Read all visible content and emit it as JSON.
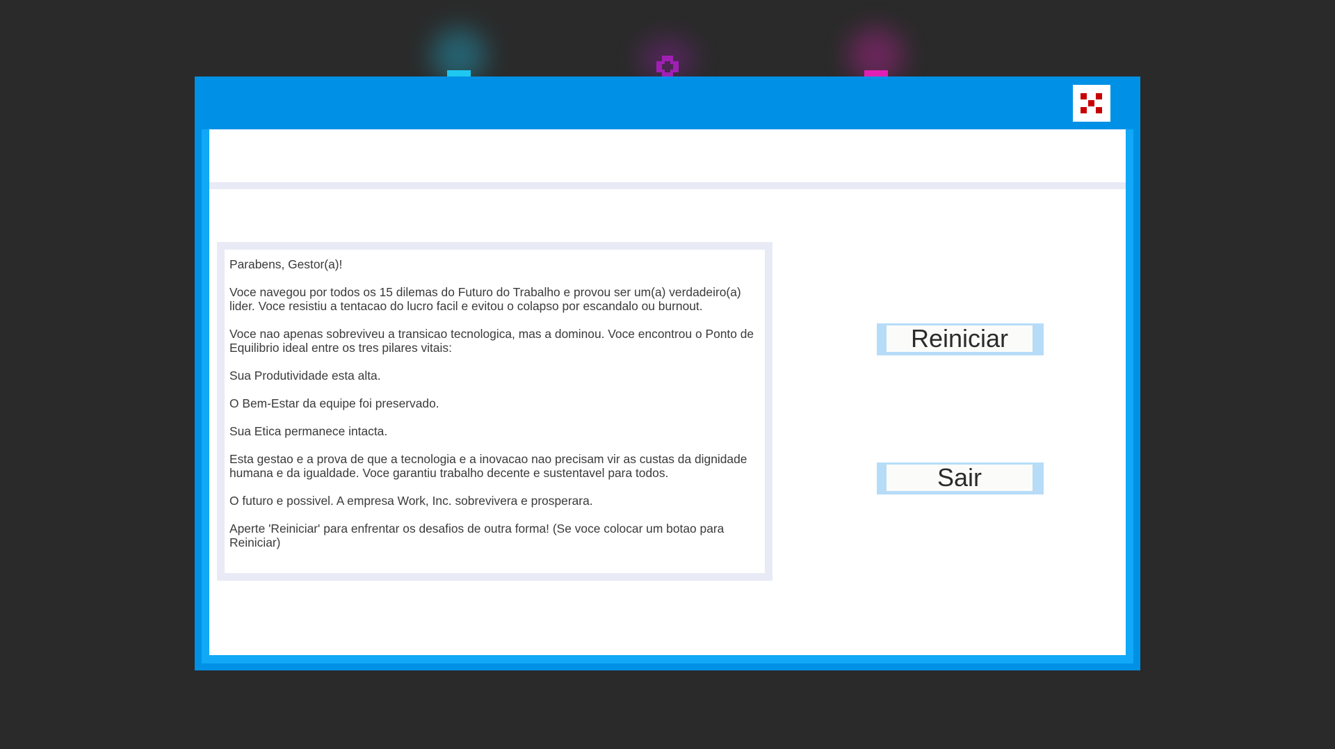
{
  "message": {
    "lines": [
      "Parabens, Gestor(a)!",
      "Voce navegou por todos os 15 dilemas do Futuro do Trabalho e provou ser um(a) verdadeiro(a) lider. Voce resistiu a tentacao do lucro facil e evitou o colapso por escandalo ou burnout.",
      "Voce nao apenas sobreviveu a transicao tecnologica, mas a dominou. Voce encontrou o Ponto de Equilibrio ideal entre os tres pilares vitais:",
      "Sua Produtividade esta alta.",
      "O Bem-Estar da equipe foi preservado.",
      "Sua Etica permanece intacta.",
      "Esta gestao e a prova de que a tecnologia e a inovacao nao precisam vir as custas da dignidade humana e da igualdade. Voce garantiu trabalho decente e sustentavel para todos.",
      "O futuro e possivel. A empresa Work, Inc. sobrevivera e prosperara.",
      "Aperte 'Reiniciar' para enfrentar os desafios de outra forma! (Se voce colocar um botao para Reiniciar)"
    ]
  },
  "buttons": {
    "restart_label": "Reiniciar",
    "exit_label": "Sair"
  },
  "icons": {
    "close": "close-pixel-x-icon"
  },
  "colors": {
    "background": "#2a2a2a",
    "window": "#0091e6",
    "close_x": "#c80000",
    "marker_cyan": "#1ec8f0",
    "marker_purple": "#a020b4",
    "marker_magenta": "#e020b4"
  }
}
